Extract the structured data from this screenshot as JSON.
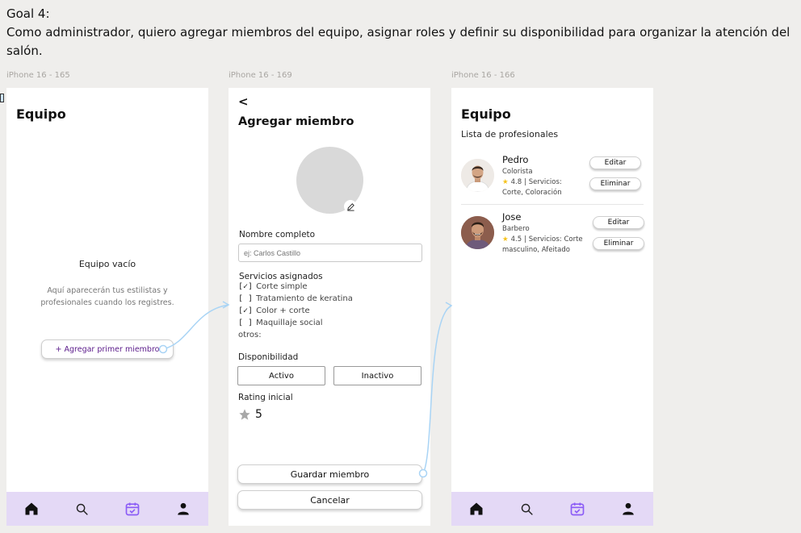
{
  "goal": {
    "title": "Goal 4:",
    "text": "Como administrador, quiero agregar miembros del equipo, asignar roles y definir su disponibilidad para organizar la atención del salón."
  },
  "frames": {
    "f1": "iPhone 16 - 165",
    "f2": "iPhone 16 - 169",
    "f3": "iPhone 16 - 166"
  },
  "screen1": {
    "title": "Equipo",
    "empty_title": "Equipo vacío",
    "empty_desc": "Aquí aparecerán tus estilistas y profesionales cuando los registres.",
    "add_button": "+ Agregar primer miembro"
  },
  "screen2": {
    "back": "<",
    "title": "Agregar miembro",
    "name_label": "Nombre completo",
    "name_placeholder": "ej: Carlos Castillo",
    "services_label": "Servicios asignados",
    "services": [
      {
        "check": "[✓]",
        "label": "Corte simple"
      },
      {
        "check": "[   ]",
        "label": "Tratamiento de keratina"
      },
      {
        "check": "[✓]",
        "label": "Color + corte"
      },
      {
        "check": "[   ]",
        "label": "Maquillaje social"
      }
    ],
    "others_label": "otros:",
    "availability_label": "Disponibilidad",
    "active_label": "Activo",
    "inactive_label": "Inactivo",
    "rating_label": "Rating inicial",
    "rating_value": "5",
    "save_button": "Guardar miembro",
    "cancel_button": "Cancelar"
  },
  "screen3": {
    "title": "Equipo",
    "subtitle": "Lista de profesionales",
    "members": [
      {
        "name": "Pedro",
        "role": "Colorista",
        "rating": "4.8",
        "services_line1": "|  Servicios:",
        "services_line2": "Corte, Coloración",
        "edit": "Editar",
        "delete": "Eliminar"
      },
      {
        "name": "Jose",
        "role": "Barbero",
        "rating": "4.5",
        "services_line1": "|  Servicios: Corte",
        "services_line2": "masculino, Afeitado",
        "edit": "Editar",
        "delete": "Eliminar"
      }
    ]
  },
  "tabbar": {
    "icons": [
      "home-icon",
      "search-icon",
      "calendar-check-icon",
      "profile-icon"
    ],
    "active_color": "#8b5cf6",
    "background": "#e4d9f6"
  },
  "colors": {
    "accent": "#8b5cf6",
    "flow_arrow": "#a9d4f5",
    "star": "#f5c21b"
  }
}
